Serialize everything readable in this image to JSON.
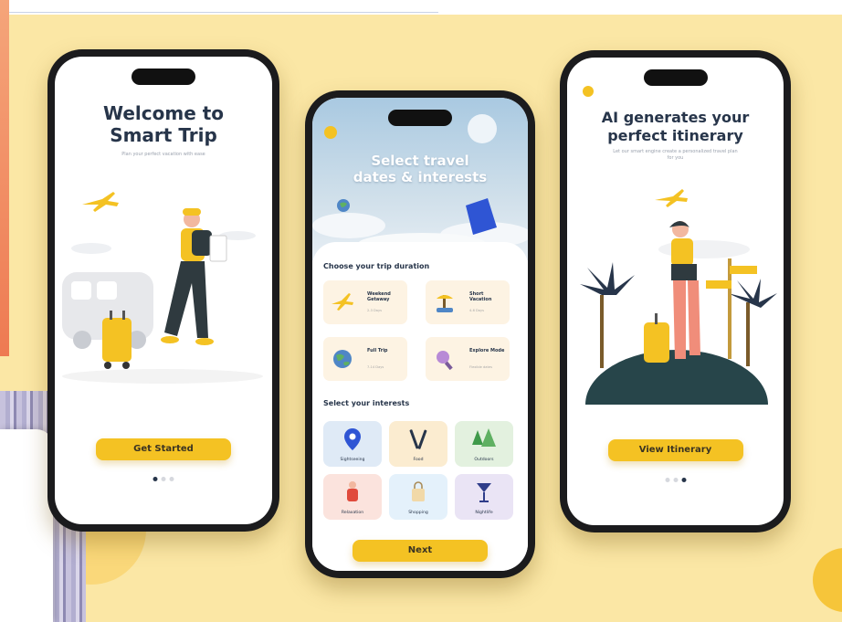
{
  "screens": [
    {
      "title_line1": "Welcome to",
      "title_line2": "Smart Trip",
      "subtitle": "Plan your perfect vacation with ease",
      "button_label": "Get Started",
      "dots": [
        true,
        false,
        false
      ]
    },
    {
      "header_line1": "Select travel",
      "header_line2": "dates & interests",
      "duration_heading": "Choose your trip duration",
      "durations": [
        {
          "title": "Weekend Getaway",
          "meta": "2-3 Days",
          "icon": "airplane-icon"
        },
        {
          "title": "Short Vacation",
          "meta": "4-6 Days",
          "icon": "beach-icon"
        },
        {
          "title": "Full Trip",
          "meta": "7-14 Days",
          "icon": "globe-icon"
        },
        {
          "title": "Explore Mode",
          "meta": "Flexible dates",
          "icon": "magnifier-icon"
        }
      ],
      "interests_heading": "Select your interests",
      "interests": [
        {
          "label": "Sightseeing",
          "color": "#dfeaf6",
          "icon": "location-pin-icon"
        },
        {
          "label": "Food",
          "color": "#fbecd0",
          "icon": "cutlery-icon"
        },
        {
          "label": "Outdoors",
          "color": "#e3f1df",
          "icon": "trees-icon"
        },
        {
          "label": "Relaxation",
          "color": "#fbe3dd",
          "icon": "person-relax-icon"
        },
        {
          "label": "Shopping",
          "color": "#e4f1fb",
          "icon": "shopping-bag-icon"
        },
        {
          "label": "Nightlife",
          "color": "#eae4f5",
          "icon": "cocktail-icon"
        }
      ],
      "button_label": "Next"
    },
    {
      "title_line1": "AI generates your",
      "title_line2": "perfect itinerary",
      "subtitle": "Let our smart engine create a personalized travel plan for you",
      "button_label": "View Itinerary",
      "dots": [
        false,
        false,
        true
      ]
    }
  ],
  "colors": {
    "background": "#fbe7a5",
    "accent": "#f4c223",
    "text": "#27354a"
  }
}
